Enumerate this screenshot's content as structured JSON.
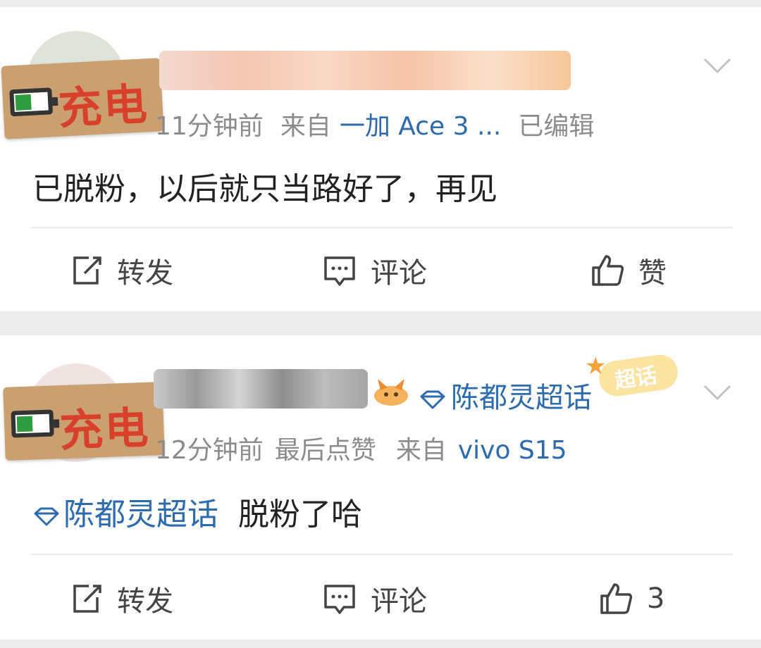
{
  "posts": [
    {
      "sticker_text": "充电",
      "time": "11分钟前",
      "from_label": "来自",
      "device": "一加 Ace 3 ...",
      "edited": "已编辑",
      "body": "已脱粉，以后就只当路好了，再见",
      "actions": {
        "repost": "转发",
        "comment": "评论",
        "like": "赞"
      }
    },
    {
      "sticker_text": "充电",
      "header_topic": "陈都灵超话",
      "badge_label": "超话",
      "time": "12分钟前",
      "last_like": "最后点赞",
      "from_label": "来自",
      "device": "vivo S15",
      "topic_tag": "陈都灵超话",
      "body": "脱粉了哈",
      "actions": {
        "repost": "转发",
        "comment": "评论",
        "like": "3"
      }
    }
  ],
  "colors": {
    "link_blue": "#2d6bb0",
    "meta_gray": "#8c8c8c",
    "sticker_red": "#d9402b",
    "card_bg": "#ffffff",
    "page_bg": "#ececec"
  },
  "icons": [
    "dropdown-chevron-icon",
    "repost-icon",
    "comment-icon",
    "like-icon",
    "battery-icon",
    "topic-gem-icon"
  ]
}
